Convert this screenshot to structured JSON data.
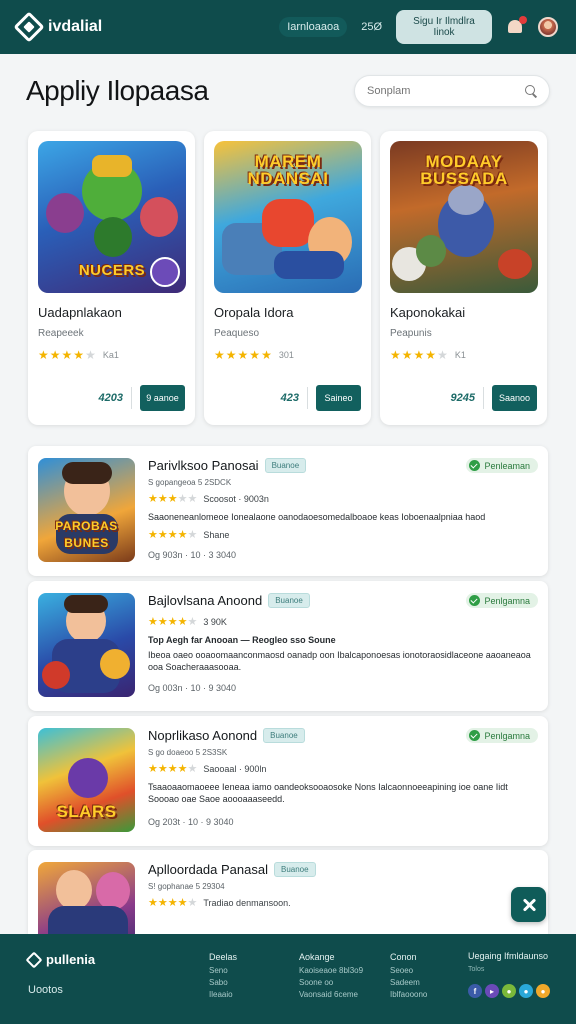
{
  "header": {
    "brand": "ivdalial",
    "nav_link": "Iarnloaaoa",
    "count": "25Ø",
    "signup_label": "Sigu Ir Ilmdlra Iinok",
    "bell_icon": "bell-icon",
    "avatar_icon": "avatar"
  },
  "page": {
    "title": "Appliy Ilopaasa",
    "search_placeholder": "Sonplam"
  },
  "featured": [
    {
      "caption": "NUCERS",
      "title": "Uadapnlakaon",
      "subtitle": "Reapeeek",
      "rating": 4,
      "rating_count": "Ka1",
      "price": "4203",
      "button": "9 aanoe"
    },
    {
      "caption": "MAREM NDANSAI",
      "title": "Oropala Idora",
      "subtitle": "Peaqueso",
      "rating": 5,
      "rating_count": "301",
      "price": "423",
      "button": "Saineo"
    },
    {
      "caption": "MODAAY BUSSADA",
      "title": "Kaponokakai",
      "subtitle": "Peapunis",
      "rating": 4,
      "rating_count": "K1",
      "price": "9245",
      "button": "Saanoo"
    }
  ],
  "list": [
    {
      "caption": "PAROBAS BUNES",
      "title": "Parivlksoo Panosai",
      "tag": "Buanoe",
      "badge": "Penleaman",
      "meta": "S gopangeoa 5 2SDCK",
      "rating_line": "Scoosot · 9003n",
      "desc": "Saaoneneanlomeoe Ionealaone oanodaoesomedalboaoe keas Ioboenaalpniaa haod",
      "rating2": "Shane",
      "foot": "Og 903n · 10 · 3 3040"
    },
    {
      "caption": "",
      "title": "Bajlovlsana Anoond",
      "tag": "Buanoe",
      "badge": "Penlgamna",
      "meta": "",
      "rating_line": "3 90K",
      "desc": "Top Aegh far Anooan — Reogleo sso Soune",
      "desc2": "Ibeoa oaeo ooaoomaanconmaosd oanadp oon Ibalcaponoesas ionotoraosidlaceone aaoaneaoa ooa Soacheraaasooaa.",
      "foot": "Og 003n · 10 · 9 3040"
    },
    {
      "caption": "SLARS",
      "title": "Noprlikaso Aonond",
      "tag": "Buanoe",
      "badge": "Penlgamna",
      "meta": "S go doaeoo 5 2S3SK",
      "rating_line": "Saooaal · 900ln",
      "desc": "Tsaaoaaomaoeee Ieneaa iamo oandeoksooaosoke Nons Ialcaonnoeeapining ioe oane Iidt Soooao oae Saoe aoooaaaseedd.",
      "foot": "Og 203t · 10 · 9 3040"
    },
    {
      "caption": "",
      "title": "Aplloordada Panasal",
      "tag": "Buanoe",
      "badge": "",
      "meta": "S! gophanae 5 29304",
      "rating_line": "Tradiao denmansoon.",
      "desc": "",
      "foot": ""
    }
  ],
  "footer": {
    "brand": "pullenia",
    "brand_sub": "Uootos",
    "col1": {
      "head": "Deelas",
      "items": [
        "Seno",
        "Sabo",
        "Ileaaio"
      ]
    },
    "col2": {
      "head": "Aokange",
      "items": [
        "Kaoiseaoe 8bl3o9",
        "Soone oo",
        "Vaonsaid 6ceme"
      ]
    },
    "col3": {
      "head": "Conon",
      "items": [
        "Seoeo",
        "Sadeem",
        "Iblfaooono"
      ]
    },
    "social_head": "Uegaing Ifmldaunso",
    "social_sub": "Tolos"
  },
  "colors": {
    "primary": "#0f4c4c",
    "accent": "#12605e",
    "star": "#f4b400",
    "badge_green": "#2f9e46"
  }
}
